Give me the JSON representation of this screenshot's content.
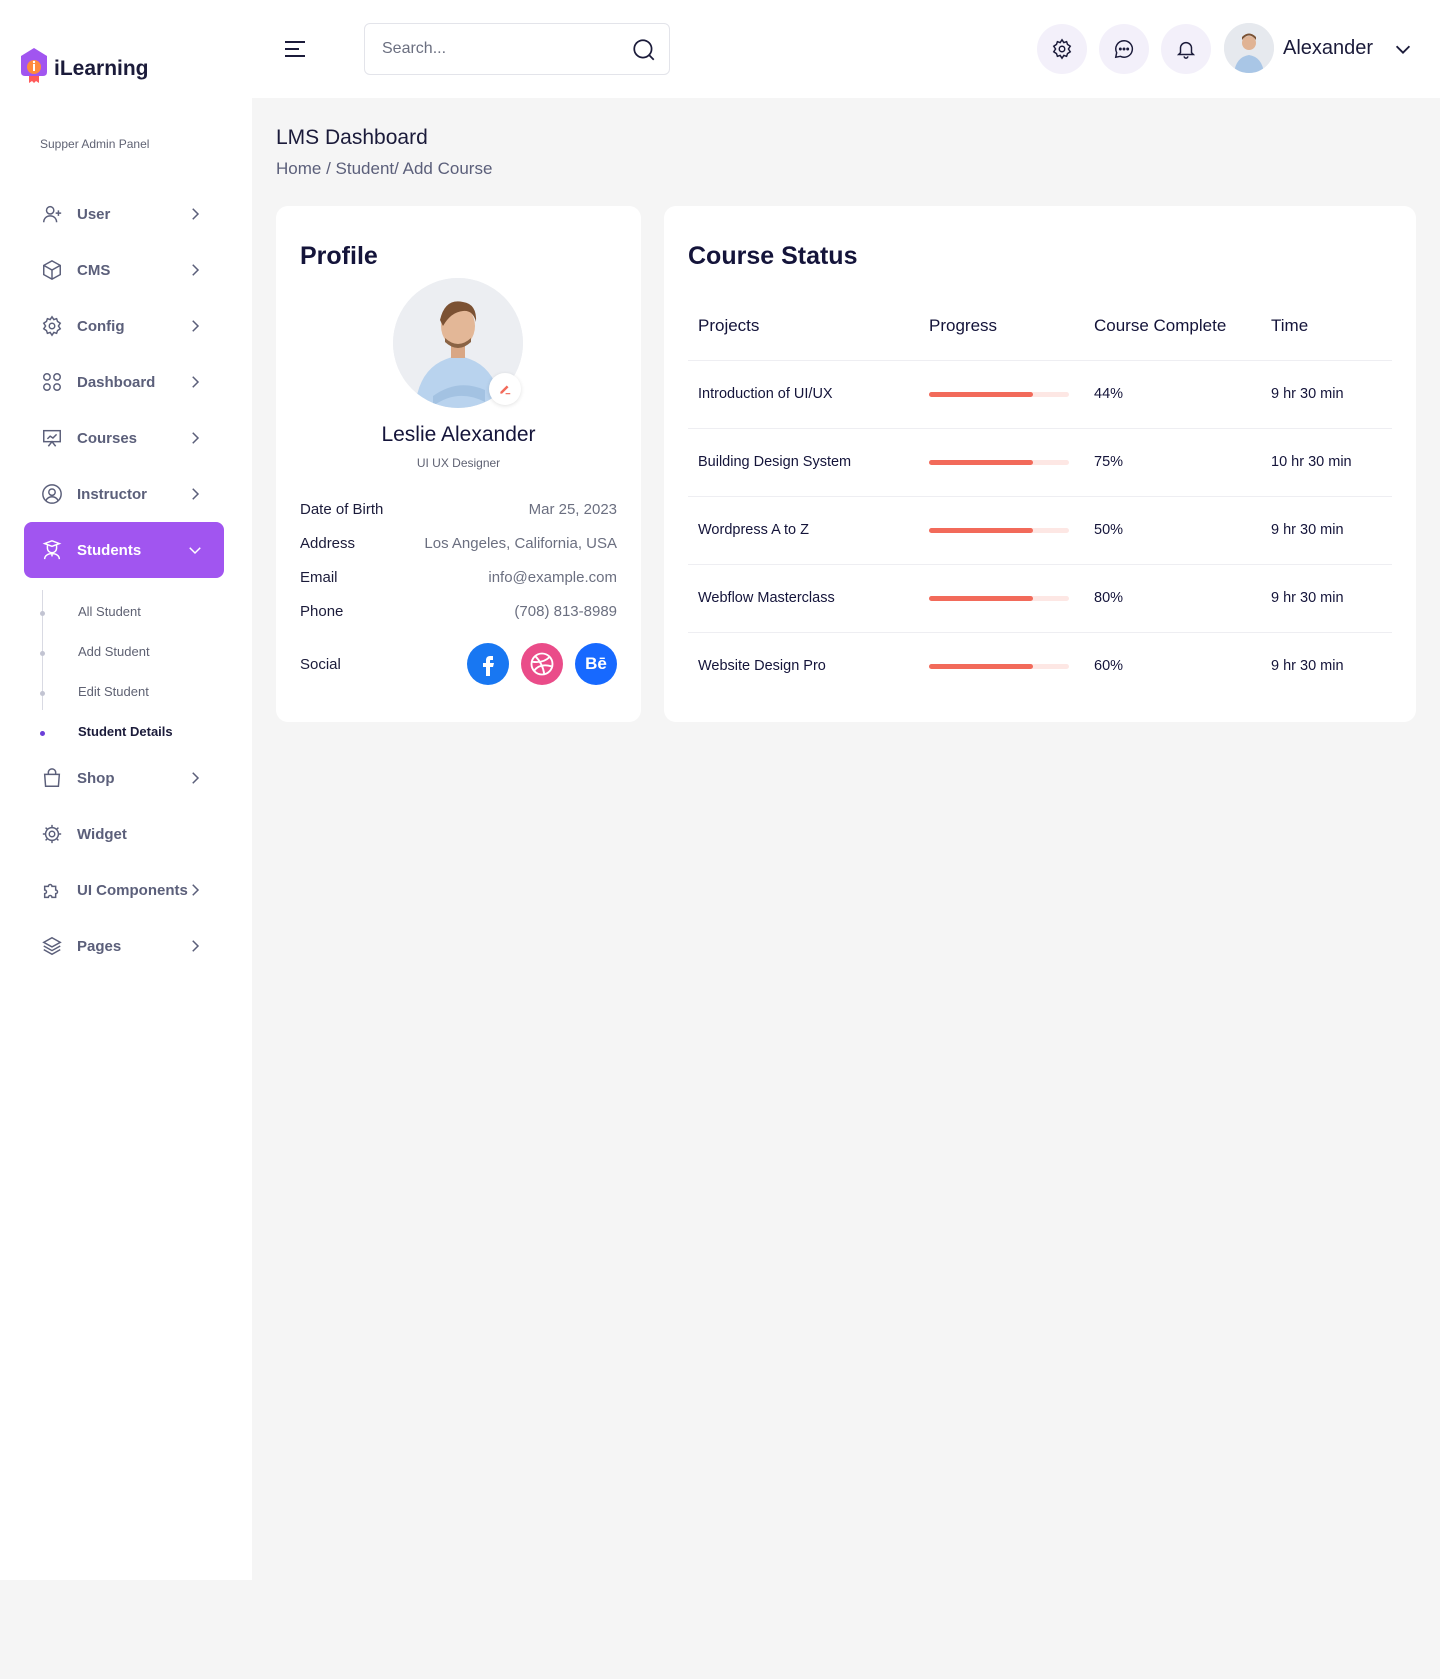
{
  "brand": {
    "name": "iLearning"
  },
  "sidebar": {
    "panel_label": "Supper Admin Panel",
    "items": [
      {
        "label": "User",
        "icon": "user-plus-icon"
      },
      {
        "label": "CMS",
        "icon": "box-icon"
      },
      {
        "label": "Config",
        "icon": "gear-icon"
      },
      {
        "label": "Dashboard",
        "icon": "grid-icon"
      },
      {
        "label": "Courses",
        "icon": "presentation-icon"
      },
      {
        "label": "Instructor",
        "icon": "user-circle-icon"
      },
      {
        "label": "Students",
        "icon": "student-icon",
        "active": true
      },
      {
        "label": "Shop",
        "icon": "bag-icon"
      },
      {
        "label": "Widget",
        "icon": "widget-gear-icon"
      },
      {
        "label": "UI Components",
        "icon": "puzzle-icon"
      },
      {
        "label": "Pages",
        "icon": "layers-icon"
      }
    ],
    "students_sub": [
      {
        "label": "All Student"
      },
      {
        "label": "Add Student"
      },
      {
        "label": "Edit Student"
      },
      {
        "label": "Student Details",
        "current": true
      }
    ]
  },
  "topbar": {
    "search_placeholder": "Search...",
    "user_name": "Alexander"
  },
  "page": {
    "title": "LMS Dashboard",
    "breadcrumb": "Home / Student/ Add Course"
  },
  "profile": {
    "title": "Profile",
    "name": "Leslie Alexander",
    "role": "UI UX Designer",
    "fields": [
      {
        "label": "Date of Birth",
        "value": "Mar 25, 2023"
      },
      {
        "label": "Address",
        "value": "Los Angeles, California, USA"
      },
      {
        "label": "Email",
        "value": "info@example.com"
      },
      {
        "label": "Phone",
        "value": "(708) 813-8989"
      }
    ],
    "social_label": "Social",
    "socials": [
      {
        "icon": "facebook-icon",
        "color": "#1877f2"
      },
      {
        "icon": "dribbble-icon",
        "color": "#ea4c89"
      },
      {
        "icon": "behance-icon",
        "glyph": "Bē",
        "color": "#1769ff"
      }
    ]
  },
  "course_status": {
    "title": "Course Status",
    "columns": [
      "Projects",
      "Progress",
      "Course Complete",
      "Time"
    ],
    "rows": [
      {
        "project": "Introduction of UI/UX",
        "progress": 0.74,
        "complete": "44%",
        "time": "9 hr 30 min"
      },
      {
        "project": "Building Design System",
        "progress": 0.74,
        "complete": "75%",
        "time": "10 hr 30 min"
      },
      {
        "project": "Wordpress A to Z",
        "progress": 0.74,
        "complete": "50%",
        "time": "9 hr 30 min"
      },
      {
        "project": "Webflow Masterclass",
        "progress": 0.74,
        "complete": "80%",
        "time": "9 hr 30 min"
      },
      {
        "project": "Website Design Pro",
        "progress": 0.74,
        "complete": "60%",
        "time": "9 hr 30 min"
      }
    ]
  },
  "colors": {
    "accent": "#a155f0",
    "progress": "#f26a5a",
    "complete": "#22c55e"
  }
}
